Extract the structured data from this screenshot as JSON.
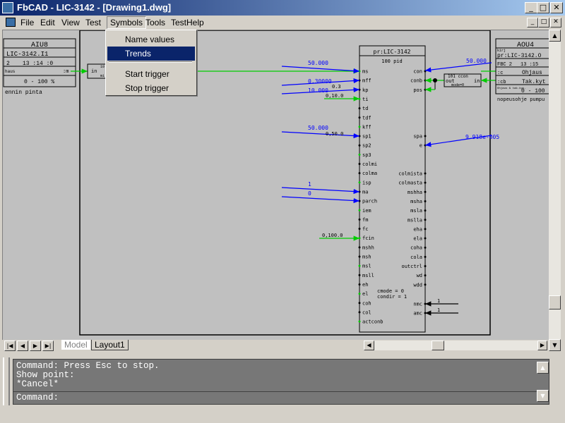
{
  "window": {
    "title": "FbCAD - LIC-3142 - [Drawing1.dwg]",
    "controls": [
      "_",
      "□",
      "✕"
    ]
  },
  "menu": {
    "items": [
      {
        "label": "File"
      },
      {
        "label": "Edit"
      },
      {
        "label": "View"
      },
      {
        "label": "Test"
      },
      {
        "label": "Symbols"
      },
      {
        "label": "Tools"
      },
      {
        "label": "TestHelp"
      }
    ],
    "active": "Symbols"
  },
  "symbols_menu": {
    "items": [
      "Name values",
      "Trends",
      "Start trigger",
      "Stop trigger"
    ],
    "selected": "Trends"
  },
  "drawing": {
    "left_box": {
      "name": "AIU8",
      "tag": "LIC-3142.I1",
      "row": [
        "2",
        "13 :14 :0"
      ],
      "small": "haus",
      "pin": ":m",
      "range": "0 - 100 %",
      "note": "ennin pinta"
    },
    "mid_box": {
      "in": "in",
      "top": "10",
      "small": "mi"
    },
    "right_box": {
      "name": "AOU4",
      "small": "kirj",
      "tag": "pr:LIC-3142.O",
      "row": [
        "FBC 2",
        "13 :15"
      ],
      "pin_c": ":c",
      "pin_cb": ":cb",
      "label1": "Ohjaus",
      "label2": "Tak.kyt",
      "small2": "Ohjaus & tak.kyt.",
      "range": "0 - 100",
      "note": "nopeusohje pumpu"
    },
    "pid_block": {
      "name": "pr:LIC-3142",
      "type": "100 pid",
      "inputs": [
        "ms",
        "mff",
        "kp",
        "ti",
        "td",
        "tdf",
        "kff",
        "sp1",
        "sp2",
        "sp3",
        "colmi",
        "colma",
        "isp",
        "ma",
        "parch",
        "iem",
        "fm",
        "fc",
        "fcin",
        "mshh",
        "msh",
        "msl",
        "msll",
        "eh",
        "el",
        "coh",
        "col",
        "actconb"
      ],
      "outputs_top": [
        "con",
        "conb",
        "pos"
      ],
      "outputs_mid": [
        "spa",
        "e"
      ],
      "outputs_list": [
        "colmista",
        "colmasta",
        "mshha",
        "msha",
        "msla",
        "mslla",
        "eha",
        "ela",
        "coha",
        "cola",
        "outctrl",
        "wd",
        "wdd"
      ],
      "params": [
        "cmode = 0",
        "condir = 1"
      ],
      "bottom_pins": [
        "nmc",
        "amc"
      ]
    },
    "values": {
      "ms": "50.000",
      "mff": "0.30000",
      "kp_over": "0.3",
      "kp": "10.000",
      "ti": "0,10.0",
      "kff": "50.000",
      "sp1": "0,50.0",
      "isp": "1",
      "ma": "0",
      "fcin": "0,100.0",
      "con": "50.000",
      "e": "9.918e-005",
      "nmc": "1",
      "amc": "1"
    },
    "ao_block": {
      "type": "101 ccon",
      "out": "out",
      "in": "in",
      "mode": "mode=0"
    }
  },
  "tabs": [
    "Model",
    "Layout1"
  ],
  "command": {
    "lines": [
      "Command:  Press Esc to stop.",
      "Show point:",
      "*Cancel*"
    ],
    "prompt": "Command:"
  }
}
